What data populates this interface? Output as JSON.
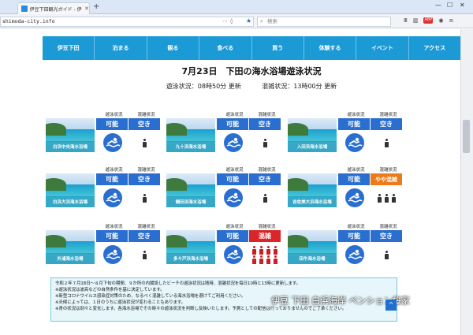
{
  "browser": {
    "tab_title": "伊豆下田観光ガイド - 伊豆下田のビー",
    "url": "shimoda-city.info",
    "search_placeholder": "検索"
  },
  "nav": {
    "items": [
      "伊豆下田",
      "泊まる",
      "観る",
      "食べる",
      "買う",
      "体験する",
      "イベント",
      "アクセス"
    ]
  },
  "page": {
    "headline": "7月23日　下田の海水浴場遊泳状況",
    "swim_status": "遊泳状況：08時50分 更新",
    "crowd_status": "混雑状況：13時00分 更新"
  },
  "column_headers": {
    "swim": "遊泳状況",
    "crowd": "混雑状況"
  },
  "beaches": [
    {
      "name": "白浜中央海水浴場",
      "swim": "可能",
      "crowd": "空き",
      "crowd_level": 1,
      "crowd_color": "blue"
    },
    {
      "name": "九十浜海水浴場",
      "swim": "可能",
      "crowd": "空き",
      "crowd_level": 1,
      "crowd_color": "blue"
    },
    {
      "name": "入田浜海水浴場",
      "swim": "可能",
      "crowd": "空き",
      "crowd_level": 1,
      "crowd_color": "blue"
    },
    {
      "name": "白浜大浜海水浴場",
      "swim": "可能",
      "crowd": "空き",
      "crowd_level": 1,
      "crowd_color": "blue"
    },
    {
      "name": "鍋田浜海水浴場",
      "swim": "可能",
      "crowd": "空き",
      "crowd_level": 1,
      "crowd_color": "blue"
    },
    {
      "name": "吉佐美大浜海水浴場",
      "swim": "可能",
      "crowd": "やや混雑",
      "crowd_level": 3,
      "crowd_color": "orange"
    },
    {
      "name": "外浦海水浴場",
      "swim": "可能",
      "crowd": "空き",
      "crowd_level": 1,
      "crowd_color": "blue"
    },
    {
      "name": "多々戸浜海水浴場",
      "swim": "可能",
      "crowd": "混雑",
      "crowd_level": 8,
      "crowd_color": "red"
    },
    {
      "name": "田牛海水浴場",
      "swim": "可能",
      "crowd": "空き",
      "crowd_level": 1,
      "crowd_color": "blue"
    }
  ],
  "notice": [
    "令和２年７月18日〜８月下旬の期間、９か所の内閣設したビーチの遊泳状況は随時、混雑状況を毎日10時と13時に更新します。",
    "※遊泳状況は波高などの自然条件を基に決定しています。",
    "※新型コロナウイルス感染症対策のため、なるべく混雑している海水浴場を避けてご利用ください。",
    "※天候によっては、１日のうちに遊泳状況が変わることもあります。",
    "※青の状況は刻々と変化します。各海水浴場でその時々の遊泳状況を判断し反映いたします。予測としての配信は行っておりませんのでご了承ください。"
  ],
  "watermark": "伊豆 下田 白浜海岸 ペンション桜家",
  "colors": {
    "nav_blue": "#1b9ad6",
    "status_blue": "#2a6fcf",
    "orange": "#ee7a18",
    "red": "#d8262a"
  }
}
